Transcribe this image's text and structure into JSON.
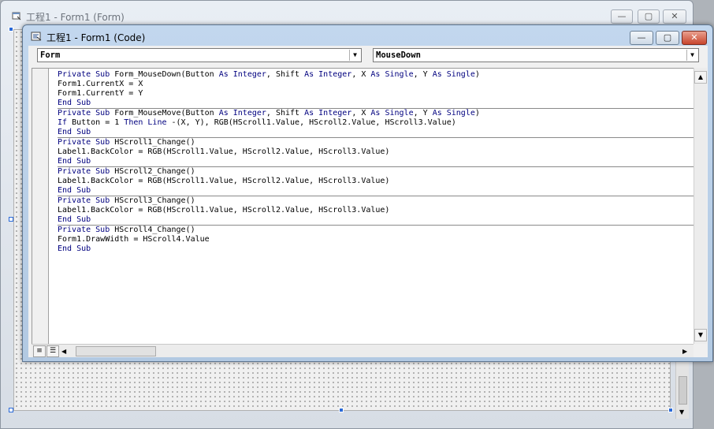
{
  "form_window": {
    "title": "工程1 - Form1 (Form)",
    "buttons": {
      "minimize": "—",
      "maximize": "▢",
      "close": "✕"
    }
  },
  "code_window": {
    "title": "工程1 - Form1 (Code)",
    "buttons": {
      "minimize": "—",
      "maximize": "▢",
      "close": "✕"
    },
    "object_combo": "Form",
    "procedure_combo": "MouseDown"
  },
  "code": {
    "procedures": [
      {
        "lines": [
          [
            [
              "kw",
              "Private Sub "
            ],
            [
              "t",
              "Form_MouseDown(Button "
            ],
            [
              "kw",
              "As Integer"
            ],
            [
              "t",
              ", Shift "
            ],
            [
              "kw",
              "As Integer"
            ],
            [
              "t",
              ", X "
            ],
            [
              "kw",
              "As Single"
            ],
            [
              "t",
              ", Y "
            ],
            [
              "kw",
              "As Single"
            ],
            [
              "t",
              ")"
            ]
          ],
          [
            [
              "t",
              "Form1.CurrentX = X"
            ]
          ],
          [
            [
              "t",
              "Form1.CurrentY = Y"
            ]
          ],
          [
            [
              "kw",
              "End Sub"
            ]
          ]
        ]
      },
      {
        "lines": [
          [
            [
              "kw",
              "Private Sub "
            ],
            [
              "t",
              "Form_MouseMove(Button "
            ],
            [
              "kw",
              "As Integer"
            ],
            [
              "t",
              ", Shift "
            ],
            [
              "kw",
              "As Integer"
            ],
            [
              "t",
              ", X "
            ],
            [
              "kw",
              "As Single"
            ],
            [
              "t",
              ", Y "
            ],
            [
              "kw",
              "As Single"
            ],
            [
              "t",
              ")"
            ]
          ],
          [
            [
              "kw",
              "If "
            ],
            [
              "t",
              "Button = 1 "
            ],
            [
              "kw",
              "Then "
            ],
            [
              "kw",
              "Line "
            ],
            [
              "t",
              "-(X, Y), RGB(HScroll1.Value, HScroll2.Value, HScroll3.Value)"
            ]
          ],
          [
            [
              "kw",
              "End Sub"
            ]
          ]
        ]
      },
      {
        "lines": [
          [
            [
              "kw",
              "Private Sub "
            ],
            [
              "t",
              "HScroll1_Change()"
            ]
          ],
          [
            [
              "t",
              "Label1.BackColor = RGB(HScroll1.Value, HScroll2.Value, HScroll3.Value)"
            ]
          ],
          [
            [
              "kw",
              "End Sub"
            ]
          ]
        ]
      },
      {
        "lines": [
          [
            [
              "kw",
              "Private Sub "
            ],
            [
              "t",
              "HScroll2_Change()"
            ]
          ],
          [
            [
              "t",
              "Label1.BackColor = RGB(HScroll1.Value, HScroll2.Value, HScroll3.Value)"
            ]
          ],
          [
            [
              "kw",
              "End Sub"
            ]
          ]
        ]
      },
      {
        "lines": [
          [
            [
              "kw",
              "Private Sub "
            ],
            [
              "t",
              "HScroll3_Change()"
            ]
          ],
          [
            [
              "t",
              "Label1.BackColor = RGB(HScroll1.Value, HScroll2.Value, HScroll3.Value)"
            ]
          ],
          [
            [
              "kw",
              "End Sub"
            ]
          ]
        ]
      },
      {
        "lines": [
          [
            [
              "kw",
              "Private Sub "
            ],
            [
              "t",
              "HScroll4_Change()"
            ]
          ],
          [
            [
              "t",
              "Form1.DrawWidth = HScroll4.Value"
            ]
          ],
          [
            [
              "kw",
              "End Sub"
            ]
          ]
        ]
      }
    ]
  },
  "colors": {
    "keyword": "#00007f",
    "text": "#000000"
  },
  "icons": {
    "form_window": "form-window-icon",
    "code_window": "code-window-icon",
    "procedure_view": "procedure-view-icon",
    "full_module_view": "full-module-view-icon"
  }
}
